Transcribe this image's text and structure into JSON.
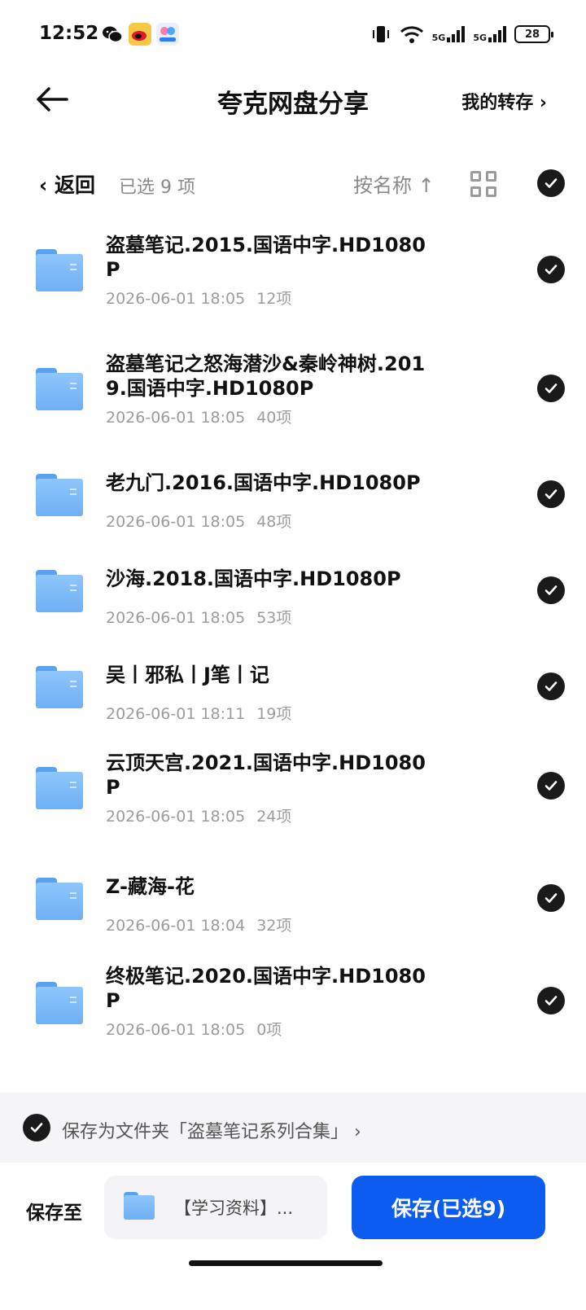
{
  "status_bar": {
    "time": "12:52",
    "battery": "28",
    "net1": "5G",
    "net2": "5G"
  },
  "header": {
    "title": "夸克网盘分享",
    "my_save": "我的转存 ›"
  },
  "toolbar": {
    "back": "‹ 返回",
    "selected_count": "已选 9 项",
    "sort": "按名称 ↑"
  },
  "items": [
    {
      "name": "盗墓笔记.2015.国语中字.HD1080P",
      "date": "2026-06-01 18:05",
      "count": "12项"
    },
    {
      "name": "盗墓笔记之怒海潜沙&秦岭神树.2019.国语中字.HD1080P",
      "date": "2026-06-01 18:05",
      "count": "40项"
    },
    {
      "name": "老九门.2016.国语中字.HD1080P",
      "date": "2026-06-01 18:05",
      "count": "48项"
    },
    {
      "name": "沙海.2018.国语中字.HD1080P",
      "date": "2026-06-01 18:05",
      "count": "53项"
    },
    {
      "name": "吴丨邪私丨J笔丨记",
      "date": "2026-06-01 18:11",
      "count": "19项"
    },
    {
      "name": "云顶天宫.2021.国语中字.HD1080P",
      "date": "2026-06-01 18:05",
      "count": "24项"
    },
    {
      "name": "Z-藏海-花",
      "date": "2026-06-01 18:04",
      "count": "32项"
    },
    {
      "name": "终极笔记.2020.国语中字.HD1080P",
      "date": "2026-06-01 18:05",
      "count": "0项"
    }
  ],
  "save_as_folder": "保存为文件夹「盗墓笔记系列合集」 ›",
  "bottom": {
    "save_to": "保存至",
    "destination": "【学习资料】...",
    "save_button": "保存(已选9)"
  },
  "colors": {
    "accent": "#0d5cf0",
    "folder": "#7ab8f7",
    "check": "#1a1a1a"
  }
}
